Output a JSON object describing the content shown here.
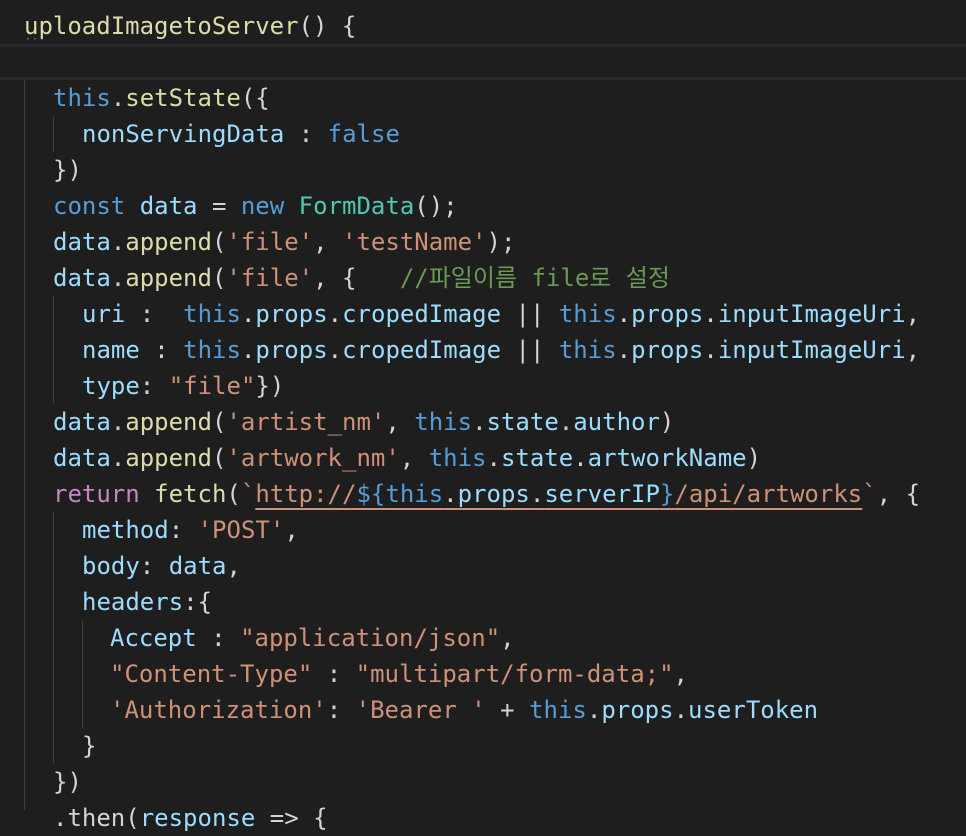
{
  "editor": {
    "lines": [
      {
        "id": "l1",
        "tokens": [
          [
            "f",
            "uploadImagetoServer"
          ],
          [
            "p",
            "() {"
          ]
        ]
      },
      {
        "id": "l2",
        "tokens": []
      },
      {
        "id": "l3",
        "tokens": [
          [
            "k",
            "this"
          ],
          [
            "p",
            "."
          ],
          [
            "f",
            "setState"
          ],
          [
            "p",
            "({"
          ]
        ]
      },
      {
        "id": "l4",
        "tokens": [
          [
            "v",
            "nonServingData"
          ],
          [
            "p",
            " : "
          ],
          [
            "k",
            "false"
          ]
        ]
      },
      {
        "id": "l5",
        "tokens": [
          [
            "p",
            "})"
          ]
        ]
      },
      {
        "id": "l6",
        "tokens": [
          [
            "k",
            "const"
          ],
          [
            "p",
            " "
          ],
          [
            "v",
            "data"
          ],
          [
            "p",
            " = "
          ],
          [
            "k",
            "new"
          ],
          [
            "p",
            " "
          ],
          [
            "t",
            "FormData"
          ],
          [
            "p",
            "();"
          ]
        ]
      },
      {
        "id": "l7",
        "tokens": [
          [
            "v",
            "data"
          ],
          [
            "p",
            "."
          ],
          [
            "f",
            "append"
          ],
          [
            "p",
            "("
          ],
          [
            "s",
            "'file'"
          ],
          [
            "p",
            ", "
          ],
          [
            "s",
            "'testName'"
          ],
          [
            "p",
            ");"
          ]
        ]
      },
      {
        "id": "l8",
        "tokens": [
          [
            "v",
            "data"
          ],
          [
            "p",
            "."
          ],
          [
            "f",
            "append"
          ],
          [
            "p",
            "("
          ],
          [
            "s",
            "'file'"
          ],
          [
            "p",
            ", {   "
          ],
          [
            "c",
            "//파일이름 file로 설정"
          ]
        ]
      },
      {
        "id": "l9",
        "tokens": [
          [
            "v",
            "uri"
          ],
          [
            "p",
            " :  "
          ],
          [
            "k",
            "this"
          ],
          [
            "p",
            "."
          ],
          [
            "v",
            "props"
          ],
          [
            "p",
            "."
          ],
          [
            "v",
            "cropedImage"
          ],
          [
            "p",
            " || "
          ],
          [
            "k",
            "this"
          ],
          [
            "p",
            "."
          ],
          [
            "v",
            "props"
          ],
          [
            "p",
            "."
          ],
          [
            "v",
            "inputImageUri"
          ],
          [
            "p",
            ","
          ]
        ]
      },
      {
        "id": "l10",
        "tokens": [
          [
            "v",
            "name"
          ],
          [
            "p",
            " : "
          ],
          [
            "k",
            "this"
          ],
          [
            "p",
            "."
          ],
          [
            "v",
            "props"
          ],
          [
            "p",
            "."
          ],
          [
            "v",
            "cropedImage"
          ],
          [
            "p",
            " || "
          ],
          [
            "k",
            "this"
          ],
          [
            "p",
            "."
          ],
          [
            "v",
            "props"
          ],
          [
            "p",
            "."
          ],
          [
            "v",
            "inputImageUri"
          ],
          [
            "p",
            ","
          ]
        ]
      },
      {
        "id": "l11",
        "tokens": [
          [
            "v",
            "type"
          ],
          [
            "p",
            ": "
          ],
          [
            "s",
            "\"file\""
          ],
          [
            "p",
            "})"
          ]
        ]
      },
      {
        "id": "l12",
        "tokens": [
          [
            "v",
            "data"
          ],
          [
            "p",
            "."
          ],
          [
            "f",
            "append"
          ],
          [
            "p",
            "("
          ],
          [
            "s",
            "'artist_nm'"
          ],
          [
            "p",
            ", "
          ],
          [
            "k",
            "this"
          ],
          [
            "p",
            "."
          ],
          [
            "v",
            "state"
          ],
          [
            "p",
            "."
          ],
          [
            "v",
            "author"
          ],
          [
            "p",
            ")"
          ]
        ]
      },
      {
        "id": "l13",
        "tokens": [
          [
            "v",
            "data"
          ],
          [
            "p",
            "."
          ],
          [
            "f",
            "append"
          ],
          [
            "p",
            "("
          ],
          [
            "s",
            "'artwork_nm'"
          ],
          [
            "p",
            ", "
          ],
          [
            "k",
            "this"
          ],
          [
            "p",
            "."
          ],
          [
            "v",
            "state"
          ],
          [
            "p",
            "."
          ],
          [
            "v",
            "artworkName"
          ],
          [
            "p",
            ")"
          ]
        ]
      },
      {
        "id": "l14",
        "tokens": [
          [
            "kc",
            "return"
          ],
          [
            "p",
            " "
          ],
          [
            "f",
            "fetch"
          ],
          [
            "p",
            "("
          ],
          [
            "s",
            "`"
          ],
          [
            "s ul",
            "http://"
          ],
          [
            "tpl ul",
            "${"
          ],
          [
            "k ul",
            "this"
          ],
          [
            "p ul",
            "."
          ],
          [
            "v ul",
            "props"
          ],
          [
            "p ul",
            "."
          ],
          [
            "v ul",
            "serverIP"
          ],
          [
            "tpl ul",
            "}"
          ],
          [
            "s ul",
            "/api/artworks"
          ],
          [
            "s",
            "`"
          ],
          [
            "p",
            ", {"
          ]
        ]
      },
      {
        "id": "l15",
        "tokens": [
          [
            "v",
            "method"
          ],
          [
            "p",
            ": "
          ],
          [
            "s",
            "'POST'"
          ],
          [
            "p",
            ","
          ]
        ]
      },
      {
        "id": "l16",
        "tokens": [
          [
            "v",
            "body"
          ],
          [
            "p",
            ": "
          ],
          [
            "v",
            "data"
          ],
          [
            "p",
            ","
          ]
        ]
      },
      {
        "id": "l17",
        "tokens": [
          [
            "v",
            "headers"
          ],
          [
            "p",
            ":{"
          ]
        ]
      },
      {
        "id": "l18",
        "tokens": [
          [
            "v",
            "Accept"
          ],
          [
            "p",
            " : "
          ],
          [
            "s",
            "\"application/json\""
          ],
          [
            "p",
            ","
          ]
        ]
      },
      {
        "id": "l19",
        "tokens": [
          [
            "s",
            "\"Content-Type\""
          ],
          [
            "p",
            " : "
          ],
          [
            "s",
            "\"multipart/form-data;\""
          ],
          [
            "p",
            ","
          ]
        ]
      },
      {
        "id": "l20",
        "tokens": [
          [
            "s",
            "'Authorization'"
          ],
          [
            "p",
            ": "
          ],
          [
            "s",
            "'Bearer '"
          ],
          [
            "p",
            " + "
          ],
          [
            "k",
            "this"
          ],
          [
            "p",
            "."
          ],
          [
            "v",
            "props"
          ],
          [
            "p",
            "."
          ],
          [
            "v",
            "userToken"
          ]
        ]
      },
      {
        "id": "l21",
        "tokens": [
          [
            "p",
            "}"
          ]
        ]
      },
      {
        "id": "l22",
        "tokens": [
          [
            "p",
            "})"
          ]
        ]
      },
      {
        "id": "l23",
        "tokens": [
          [
            "p",
            ".then("
          ],
          [
            "v",
            "response"
          ],
          [
            "p",
            " => {"
          ]
        ]
      }
    ]
  }
}
